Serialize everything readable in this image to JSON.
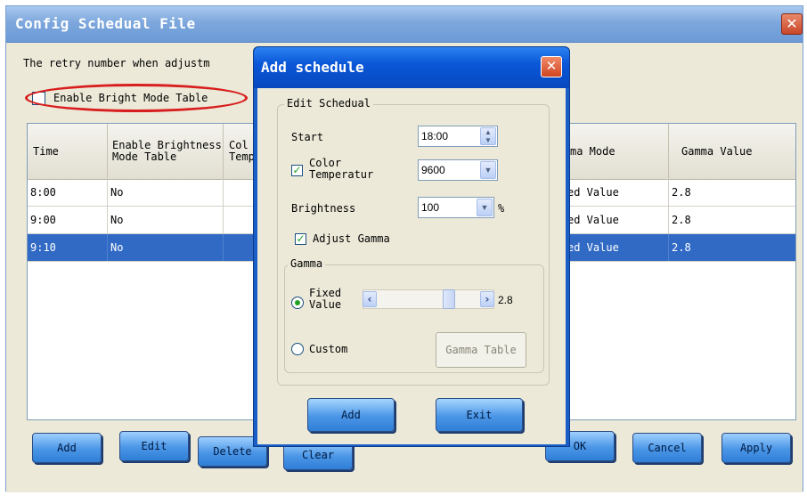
{
  "main": {
    "title": "Config Schedual File",
    "close_glyph": "✕",
    "retry_text": "The retry number when adjustm",
    "enable_bright_mode_label": "Enable Bright Mode Table",
    "enable_bright_mode_checked": false,
    "columns": [
      "Time",
      "Enable Brightness Mode Table",
      "Col Temp",
      "ma Mode",
      "Gamma Value"
    ],
    "rows": [
      {
        "time": "8:00",
        "enable": "No",
        "gamma_mode": "ed Value",
        "gamma_value": "2.8",
        "selected": false
      },
      {
        "time": "9:00",
        "enable": "No",
        "gamma_mode": "ed Value",
        "gamma_value": "2.8",
        "selected": false
      },
      {
        "time": "9:10",
        "enable": "No",
        "gamma_mode": "ed Value",
        "gamma_value": "2.8",
        "selected": true
      }
    ],
    "buttons": {
      "add": "Add",
      "edit": "Edit",
      "delete": "Delete",
      "clear": "Clear",
      "ok": "OK",
      "cancel": "Cancel",
      "apply": "Apply"
    },
    "selection_color": "#316ac5",
    "annotation_color": "#d81e1e"
  },
  "dialog": {
    "title": "Add schedule",
    "close_glyph": "✕",
    "edit_group_label": "Edit Schedual",
    "start_label": "Start",
    "start_value": "18:00",
    "color_temp_label_line1": "Color",
    "color_temp_label_line2": "Temperatur",
    "color_temp_checked": true,
    "color_temp_value": "9600",
    "brightness_label": "Brightness",
    "brightness_value": "100",
    "brightness_unit": "%",
    "adjust_gamma_label": "Adjust Gamma",
    "adjust_gamma_checked": true,
    "gamma_group_label": "Gamma",
    "fixed_value_label_line1": "Fixed",
    "fixed_value_label_line2": "Value",
    "fixed_value_selected": true,
    "gamma_slider_value": "2.8",
    "custom_label": "Custom",
    "gamma_table_button": "Gamma Table",
    "add_button": "Add",
    "exit_button": "Exit",
    "titlebar_color": "#0a57d8"
  }
}
